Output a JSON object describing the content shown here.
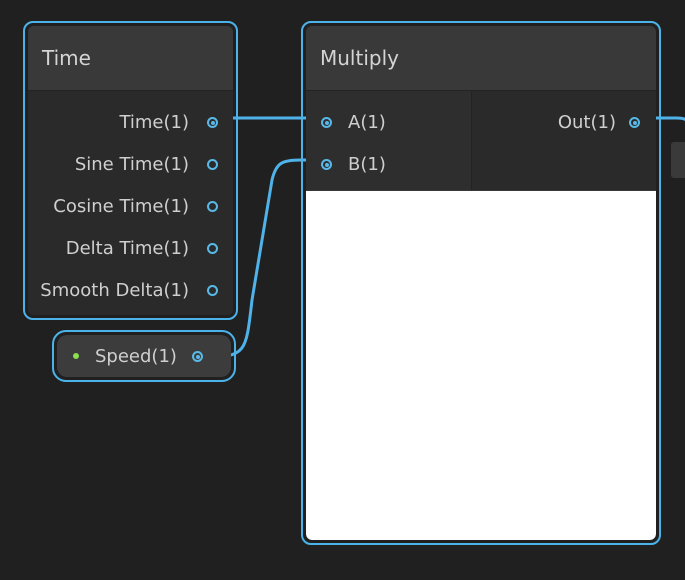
{
  "time_node": {
    "title": "Time",
    "outputs": [
      {
        "label": "Time(1)",
        "connected": true
      },
      {
        "label": "Sine Time(1)",
        "connected": false
      },
      {
        "label": "Cosine Time(1)",
        "connected": false
      },
      {
        "label": "Delta Time(1)",
        "connected": false
      },
      {
        "label": "Smooth Delta(1)",
        "connected": false
      }
    ]
  },
  "multiply_node": {
    "title": "Multiply",
    "inputs": [
      {
        "label": "A(1)",
        "connected": true
      },
      {
        "label": "B(1)",
        "connected": true
      }
    ],
    "outputs": [
      {
        "label": "Out(1)",
        "connected": true
      }
    ]
  },
  "speed_node": {
    "label": "Speed(1)"
  },
  "colors": {
    "canvas_background": "#202020",
    "node_selection_border": "#4cb3ea",
    "wire": "#4fb3ea",
    "port": "#58b9e8",
    "property_dot": "#8be04e",
    "preview_background": "#ffffff"
  }
}
